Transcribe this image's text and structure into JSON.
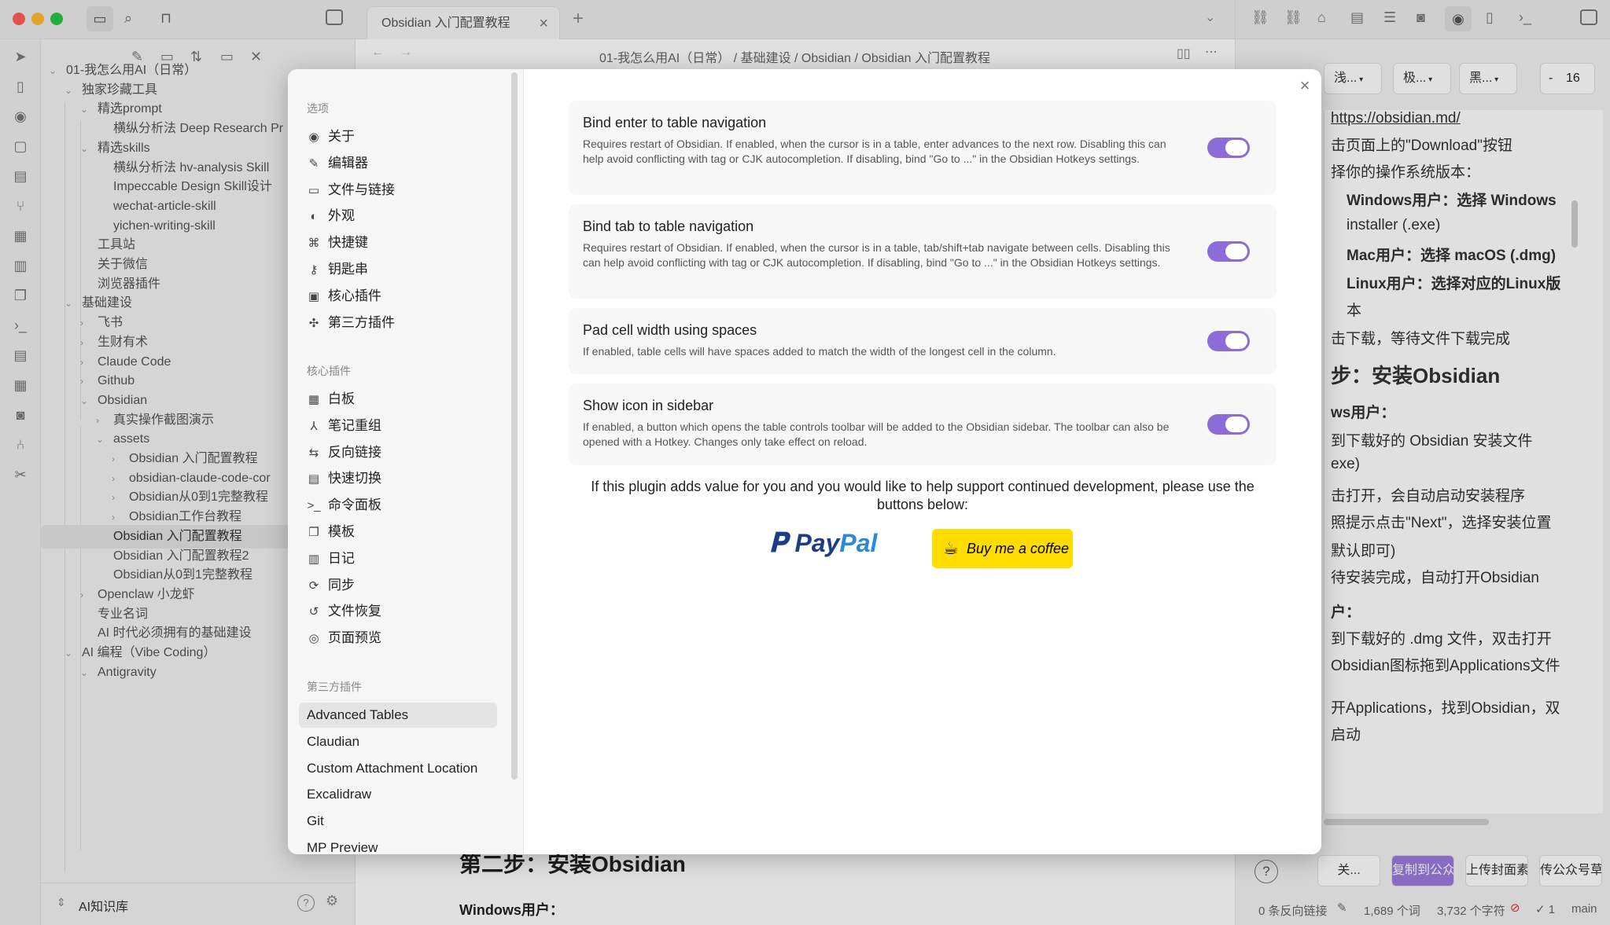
{
  "window": {
    "traffic_colors": [
      "#ff5f57",
      "#febc2e",
      "#28c840"
    ]
  },
  "tab": {
    "title": "Obsidian 入门配置教程",
    "close": "×",
    "new_tab": "+"
  },
  "breadcrumb": "01-我怎么用AI（日常） / 基础建设 / Obsidian / Obsidian 入门配置教程",
  "sidebar": {
    "vault_name": "AI知识库",
    "tree": [
      {
        "label": "01-我怎么用AI（日常）",
        "chev": "⌄"
      },
      {
        "label": "独家珍藏工具",
        "chev": "⌄"
      },
      {
        "label": "精选prompt",
        "chev": "⌄"
      },
      {
        "label": "横纵分析法 Deep Research Pr",
        "chev": ""
      },
      {
        "label": "精选skills",
        "chev": "⌄"
      },
      {
        "label": "横纵分析法 hv-analysis Skill",
        "chev": ""
      },
      {
        "label": "Impeccable Design Skill设计",
        "chev": ""
      },
      {
        "label": "wechat-article-skill",
        "chev": ""
      },
      {
        "label": "yichen-writing-skill",
        "chev": ""
      },
      {
        "label": "工具站",
        "chev": ""
      },
      {
        "label": "关于微信",
        "chev": ""
      },
      {
        "label": "浏览器插件",
        "chev": ""
      },
      {
        "label": "基础建设",
        "chev": "⌄"
      },
      {
        "label": "飞书",
        "chev": "›"
      },
      {
        "label": "生财有术",
        "chev": "›"
      },
      {
        "label": "Claude Code",
        "chev": "›"
      },
      {
        "label": "Github",
        "chev": "›"
      },
      {
        "label": "Obsidian",
        "chev": "⌄"
      },
      {
        "label": "真实操作截图演示",
        "chev": "›"
      },
      {
        "label": "assets",
        "chev": "⌄"
      },
      {
        "label": "Obsidian 入门配置教程",
        "chev": "›"
      },
      {
        "label": "obsidian-claude-code-cor",
        "chev": "›"
      },
      {
        "label": "Obsidian从0到1完整教程",
        "chev": "›"
      },
      {
        "label": "Obsidian工作台教程",
        "chev": "›"
      },
      {
        "label": "Obsidian 入门配置教程",
        "chev": ""
      },
      {
        "label": "Obsidian 入门配置教程2",
        "chev": ""
      },
      {
        "label": "Obsidian从0到1完整教程",
        "chev": ""
      },
      {
        "label": "Openclaw 小龙虾",
        "chev": "›"
      },
      {
        "label": "专业名词",
        "chev": ""
      },
      {
        "label": "AI 时代必须拥有的基础建设",
        "chev": ""
      },
      {
        "label": "AI 编程（Vibe Coding）",
        "chev": "⌄"
      },
      {
        "label": "Antigravity",
        "chev": "⌄"
      }
    ]
  },
  "editor_bg": {
    "heading": "第二步：安装Obsidian",
    "sub": "Windows用户："
  },
  "right_pane": {
    "selects": [
      "浅...",
      "极...",
      "黑..."
    ],
    "font_minus": "-",
    "font_size": "16",
    "lines": [
      "https://obsidian.md/",
      "击页面上的\"Download\"按钮",
      "择你的操作系统版本：",
      "Windows用户：选择 Windows",
      "installer (.exe)",
      "Mac用户：选择 macOS (.dmg)",
      "Linux用户：选择对应的Linux版",
      "本",
      "击下载，等待文件下载完成",
      "步：安装Obsidian",
      "ws用户：",
      "到下载好的 Obsidian 安装文件",
      "exe)",
      "击打开，会自动启动安装程序",
      "照提示点击\"Next\"，选择安装位置",
      "默认即可)",
      "待安装完成，自动打开Obsidian",
      "户：",
      "到下载好的 .dmg 文件，双击打开",
      "Obsidian图标拖到Applications文件",
      "开Applications，找到Obsidian，双",
      "启动"
    ],
    "bottom_buttons": [
      "关...",
      "复制到公众号",
      "上传封面素材",
      "传公众号草"
    ],
    "help": "?"
  },
  "status": {
    "backlinks": "0 条反向链接",
    "words": "1,689 个词",
    "chars": "3,732 个字符",
    "check": "✓ 1",
    "branch": "main"
  },
  "modal": {
    "close": "×",
    "sections": [
      {
        "heading": "选项",
        "items": [
          {
            "icon": "◉",
            "name": "about",
            "label": "关于"
          },
          {
            "icon": "✎",
            "name": "editor",
            "label": "编辑器"
          },
          {
            "icon": "▭",
            "name": "files",
            "label": "文件与链接"
          },
          {
            "icon": "◐",
            "name": "appearance",
            "label": "外观"
          },
          {
            "icon": "⌘",
            "name": "hotkeys",
            "label": "快捷键"
          },
          {
            "icon": "⚷",
            "name": "keychain",
            "label": "钥匙串"
          },
          {
            "icon": "▣",
            "name": "core-plugins",
            "label": "核心插件"
          },
          {
            "icon": "✣",
            "name": "community-plugins",
            "label": "第三方插件"
          }
        ]
      },
      {
        "heading": "核心插件",
        "items": [
          {
            "icon": "▦",
            "name": "canvas",
            "label": "白板"
          },
          {
            "icon": "⅄",
            "name": "note-composer",
            "label": "笔记重组"
          },
          {
            "icon": "⇆",
            "name": "backlinks",
            "label": "反向链接"
          },
          {
            "icon": "▤",
            "name": "quick-switcher",
            "label": "快速切换"
          },
          {
            "icon": ">_",
            "name": "command-palette",
            "label": "命令面板"
          },
          {
            "icon": "❐",
            "name": "templates",
            "label": "模板"
          },
          {
            "icon": "▥",
            "name": "daily-notes",
            "label": "日记"
          },
          {
            "icon": "⟳",
            "name": "sync",
            "label": "同步"
          },
          {
            "icon": "↺",
            "name": "file-recovery",
            "label": "文件恢复"
          },
          {
            "icon": "◎",
            "name": "page-preview",
            "label": "页面预览"
          }
        ]
      },
      {
        "heading": "第三方插件",
        "items": [
          {
            "name": "advanced-tables",
            "label": "Advanced Tables"
          },
          {
            "name": "claudian",
            "label": "Claudian"
          },
          {
            "name": "custom-attachment",
            "label": "Custom Attachment Location"
          },
          {
            "name": "excalidraw",
            "label": "Excalidraw"
          },
          {
            "name": "git",
            "label": "Git"
          },
          {
            "name": "mp-preview",
            "label": "MP Preview"
          }
        ]
      }
    ],
    "settings": [
      {
        "title": "Bind enter to table navigation",
        "desc": "Requires restart of Obsidian. If enabled, when the cursor is in a table, enter advances to the next row. Disabling this can help avoid conflicting with tag or CJK autocompletion. If disabling, bind \"Go to ...\" in the Obsidian Hotkeys settings.",
        "enabled": true
      },
      {
        "title": "Bind tab to table navigation",
        "desc": "Requires restart of Obsidian. If enabled, when the cursor is in a table, tab/shift+tab navigate between cells. Disabling this can help avoid conflicting with tag or CJK autocompletion. If disabling, bind \"Go to ...\" in the Obsidian Hotkeys settings.",
        "enabled": true
      },
      {
        "title": "Pad cell width using spaces",
        "desc": "If enabled, table cells will have spaces added to match the width of the longest cell in the column.",
        "enabled": true
      },
      {
        "title": "Show icon in sidebar",
        "desc": "If enabled, a button which opens the table controls toolbar will be added to the Obsidian sidebar. The toolbar can also be opened with a Hotkey. Changes only take effect on reload.",
        "enabled": true
      }
    ],
    "support_text": "If this plugin adds value for you and you would like to help support continued development, please use the buttons below:",
    "paypal": {
      "pay": "Pay",
      "pal": "Pal"
    },
    "bmc": "Buy me a coffee",
    "accent": "#8b6cd8"
  }
}
